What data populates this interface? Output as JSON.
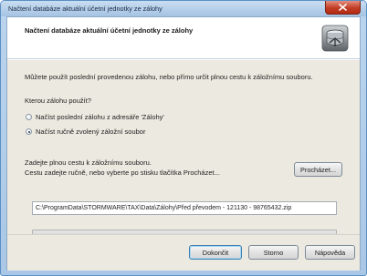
{
  "window": {
    "title": "Načtení databáze aktuální účetní jednotky ze zálohy"
  },
  "header": {
    "title": "Načtení databáze aktuální účetní jednotky ze zálohy",
    "icon": "database-icon"
  },
  "content": {
    "intro": "Můžete použít poslední provedenou zálohu, nebo přímo určit plnou cestu k záložnímu souboru.",
    "question": "Kterou zálohu použít?",
    "options": [
      {
        "label": "Načíst poslední zálohu z adresáře 'Zálohy'",
        "checked": false
      },
      {
        "label": "Načíst ručně zvolený záložní soubor",
        "checked": true
      }
    ],
    "path_instruction_1": "Zadejte plnou cestu k záložnímu souboru.",
    "path_instruction_2": "Cestu zadejte ručně, nebo vyberte po stisku tlačítka Procházet...",
    "browse_button": "Procházet...",
    "path_value": "C:\\ProgramData\\STORMWARE\\TAX\\Data\\Zálohy\\Před převodem - 121130 - 98765432.zip",
    "progress": 0
  },
  "footer": {
    "finish_button": "Dokončit",
    "cancel_button": "Storno",
    "help_button": "Nápověda"
  },
  "colors": {
    "title_bar": "#a5c3e3",
    "close_button": "#c23d25",
    "panel_background": "#ece9e0",
    "progress_fill": "#38b21b"
  }
}
